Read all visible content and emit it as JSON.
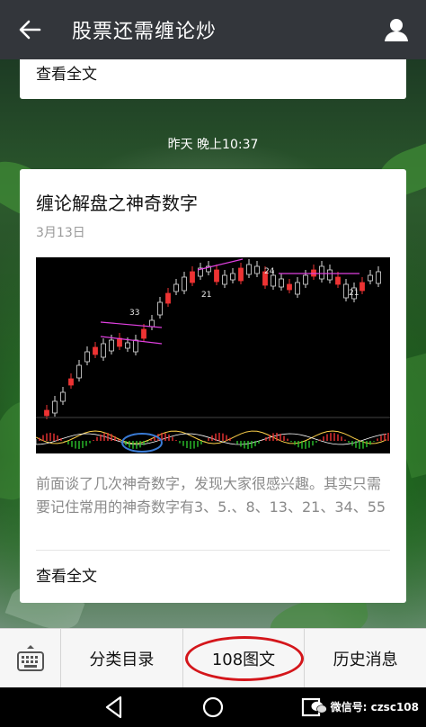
{
  "header": {
    "title": "股票还需缠论炒",
    "back_icon": "arrow-left-icon",
    "profile_icon": "person-icon"
  },
  "feed": {
    "prev_card": {
      "read_more": "查看全文"
    },
    "timestamp": "昨天 晚上10:37",
    "article": {
      "title": "缠论解盘之神奇数字",
      "date": "3月13日",
      "chart_labels": [
        "33",
        "21",
        "24",
        "21"
      ],
      "summary": "前面谈了几次神奇数字，发现大家很感兴趣。其实只需要记住常用的神奇数字有3、5.、8、13、21、34、55",
      "read_more": "查看全文"
    }
  },
  "menu": {
    "keyboard_icon": "keyboard-icon",
    "items": [
      "分类目录",
      "108图文",
      "历史消息"
    ],
    "highlight_color": "#d4161b"
  },
  "navbar": {
    "icons": [
      "back-triangle-icon",
      "home-circle-icon",
      "recents-square-icon"
    ]
  },
  "watermark": {
    "text": "微信号: czsc108"
  }
}
